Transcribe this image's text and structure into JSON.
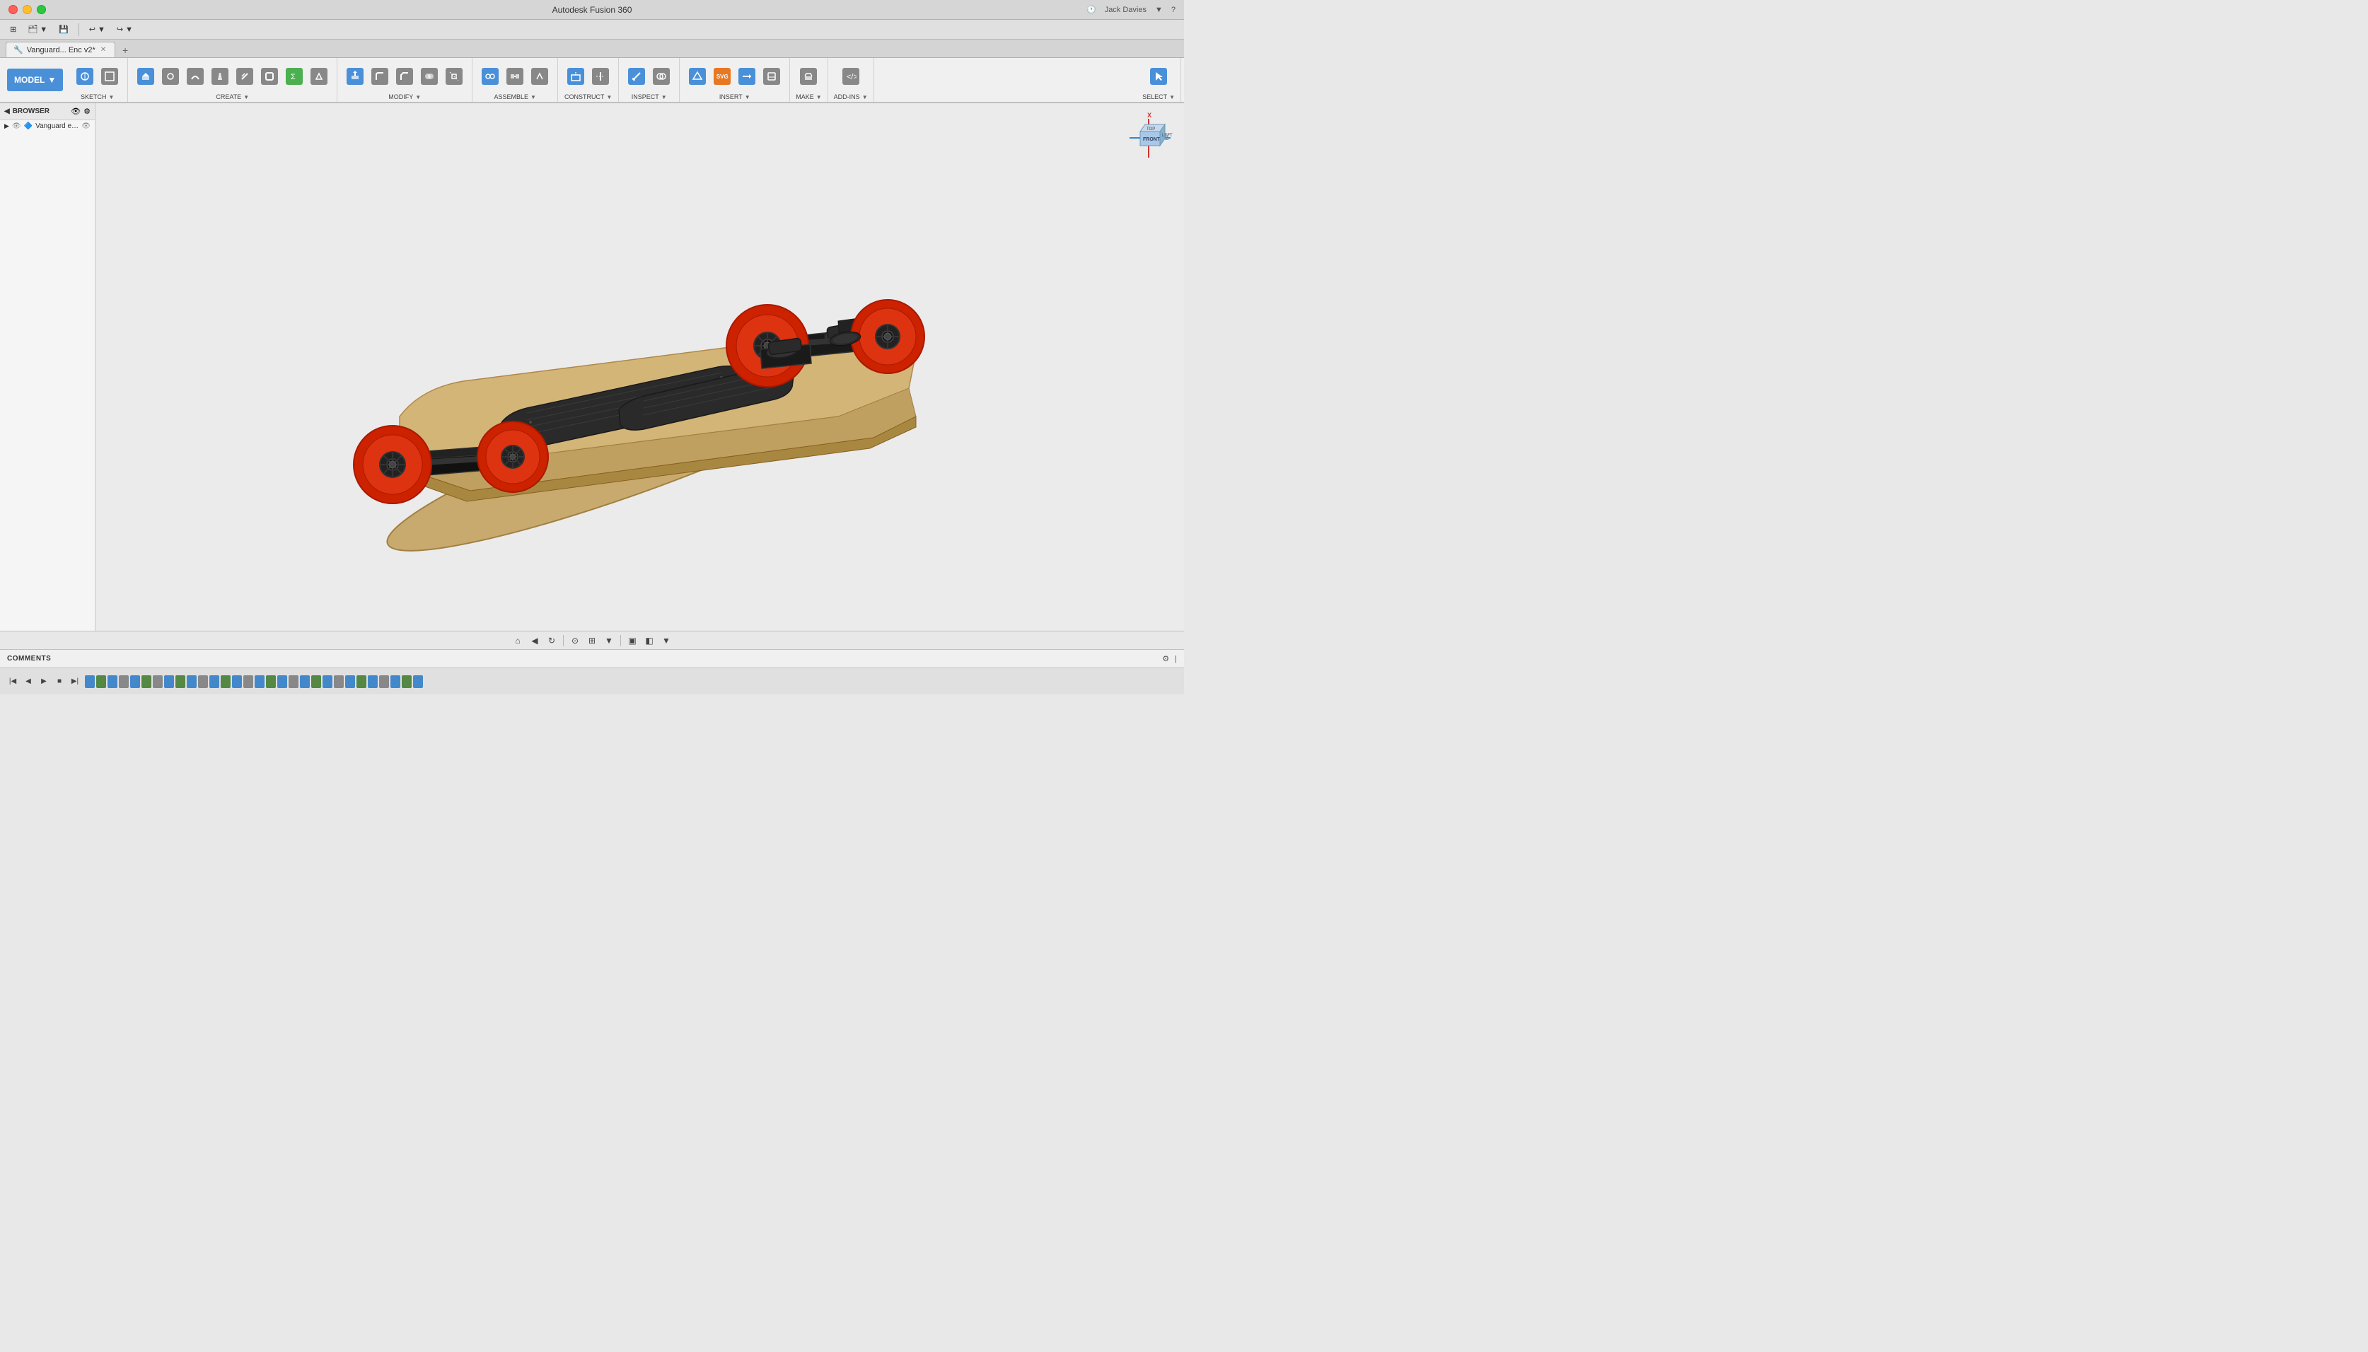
{
  "app": {
    "title": "Autodesk Fusion 360",
    "user": "Jack Davies"
  },
  "titlebar": {
    "title": "Autodesk Fusion 360",
    "user": "Jack Davies"
  },
  "toolbar": {
    "undo_label": "↩",
    "redo_label": "↪"
  },
  "tab": {
    "name": "Vanguard... Enc v2*",
    "icon": "📄"
  },
  "mode": {
    "label": "MODEL",
    "arrow": "▼"
  },
  "ribbon": {
    "sketch_label": "SKETCH",
    "create_label": "CREATE",
    "modify_label": "MODIFY",
    "assemble_label": "ASSEMBLE",
    "construct_label": "CONSTRUCT",
    "inspect_label": "INSPECT",
    "insert_label": "INSERT",
    "make_label": "MAKE",
    "addins_label": "ADD-INS",
    "select_label": "SELECT"
  },
  "browser": {
    "title": "BROWSER",
    "item": "Vanguard e-Board Final Enc..."
  },
  "comments": {
    "label": "COMMENTS"
  },
  "viewcube": {
    "front": "FRONT",
    "left": "LEFT",
    "top": "TOP"
  },
  "timeline": {
    "items_count": 30
  }
}
